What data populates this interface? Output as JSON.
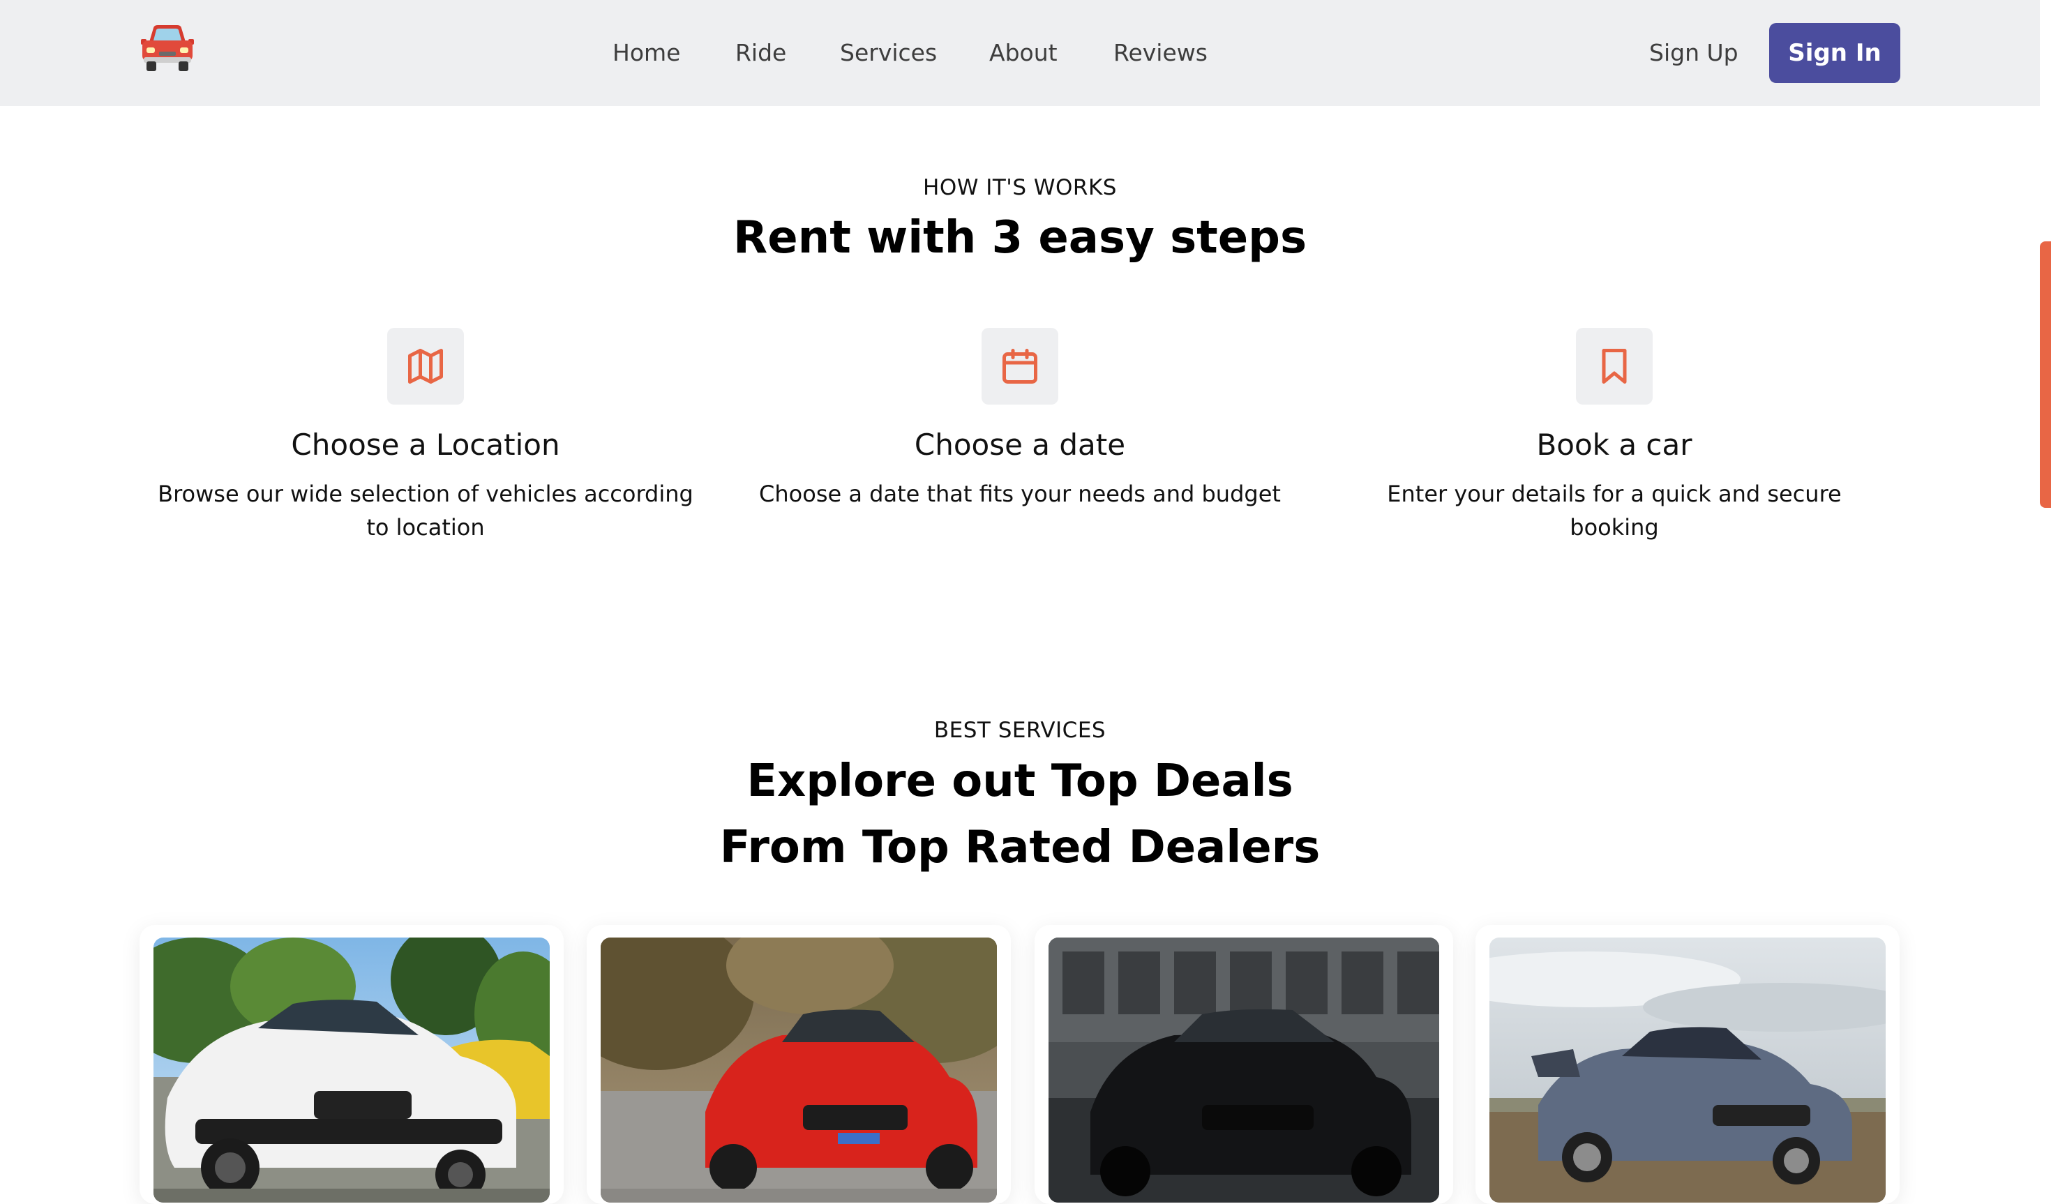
{
  "nav": {
    "logo_icon": "red-car-icon",
    "links": [
      "Home",
      "Ride",
      "Services",
      "About",
      "Reviews"
    ],
    "sign_up": "Sign Up",
    "sign_in": "Sign In"
  },
  "how": {
    "eyebrow": "HOW IT'S WORKS",
    "title": "Rent with 3 easy steps",
    "steps": [
      {
        "icon": "map-icon",
        "title": "Choose a Location",
        "desc": "Browse our wide selection of vehicles according to location"
      },
      {
        "icon": "calendar-icon",
        "title": "Choose a date",
        "desc": "Choose a date that fits your needs and budget"
      },
      {
        "icon": "bookmark-icon",
        "title": "Book a car",
        "desc": "Enter your details for a quick and secure booking"
      }
    ]
  },
  "deals": {
    "eyebrow": "BEST SERVICES",
    "title_line1": "Explore out Top Deals",
    "title_line2": "From Top Rated Dealers",
    "cards": [
      {
        "image": "white-hatchback-photo"
      },
      {
        "image": "red-hatchback-photo"
      },
      {
        "image": "black-hatchback-photo"
      },
      {
        "image": "grey-hatchback-photo"
      }
    ]
  },
  "colors": {
    "accent": "#e86645",
    "brand_button": "#4b4d9e",
    "nav_bg": "#eeeff1"
  }
}
